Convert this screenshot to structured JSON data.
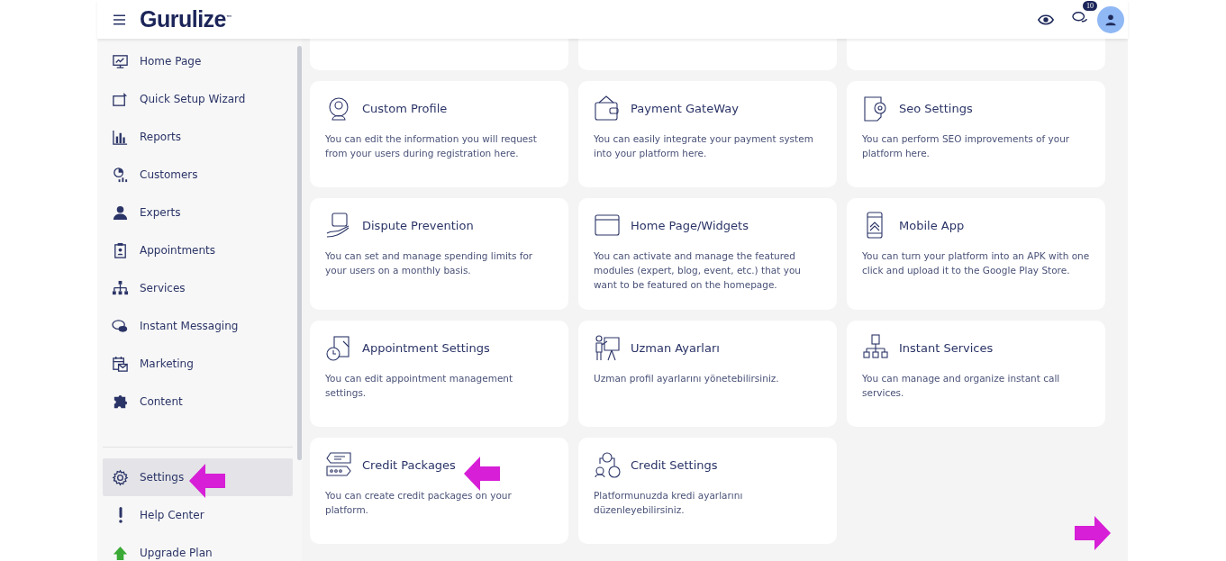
{
  "header": {
    "logo": "Gurulize$^{™}$",
    "messages_badge": "10"
  },
  "sidebar": {
    "items": [
      {
        "label": "Home Page",
        "selected": false
      },
      {
        "label": "Quick Setup Wizard",
        "selected": false
      },
      {
        "label": "Reports",
        "selected": false
      },
      {
        "label": "Customers",
        "selected": false
      },
      {
        "label": "Experts",
        "selected": false
      },
      {
        "label": "Appointments",
        "selected": false
      },
      {
        "label": "Services",
        "selected": false
      },
      {
        "label": "Instant Messaging",
        "selected": false
      },
      {
        "label": "Marketing",
        "selected": false
      },
      {
        "label": "Content",
        "selected": false
      }
    ],
    "bottom_items": [
      {
        "label": "Settings",
        "selected": true
      },
      {
        "label": "Help Center",
        "selected": false
      },
      {
        "label": "Upgrade Plan",
        "selected": false
      }
    ]
  },
  "cards": [
    {
      "title": "Custom Profile",
      "description": "You can edit the information you will request from your users during registration here."
    },
    {
      "title": "Payment GateWay",
      "description": "You can easily integrate your payment system into your platform here."
    },
    {
      "title": "Seo Settings",
      "description": "You can perform SEO improvements of your platform here."
    },
    {
      "title": "Dispute Prevention",
      "description": "You can set and manage spending limits for your users on a monthly basis."
    },
    {
      "title": "Home Page/Widgets",
      "description": "You can activate and manage the featured modules (expert, blog, event, etc.) that you want to be featured on the homepage."
    },
    {
      "title": "Mobile App",
      "description": "You can turn your platform into an APK with one click and upload it to the Google Play Store."
    },
    {
      "title": "Appointment Settings",
      "description": "You can edit appointment management settings."
    },
    {
      "title": "Uzman Ayarları",
      "description": "Uzman profil ayarlarını yönetebilirsiniz."
    },
    {
      "title": "Instant Services",
      "description": "You can manage and organize instant call services."
    },
    {
      "title": "Credit Packages",
      "description": "You can create credit packages on your platform."
    },
    {
      "title": "Credit Settings",
      "description": "Platformunuzda kredi ayarlarını düzenleyebilirsiniz."
    }
  ]
}
